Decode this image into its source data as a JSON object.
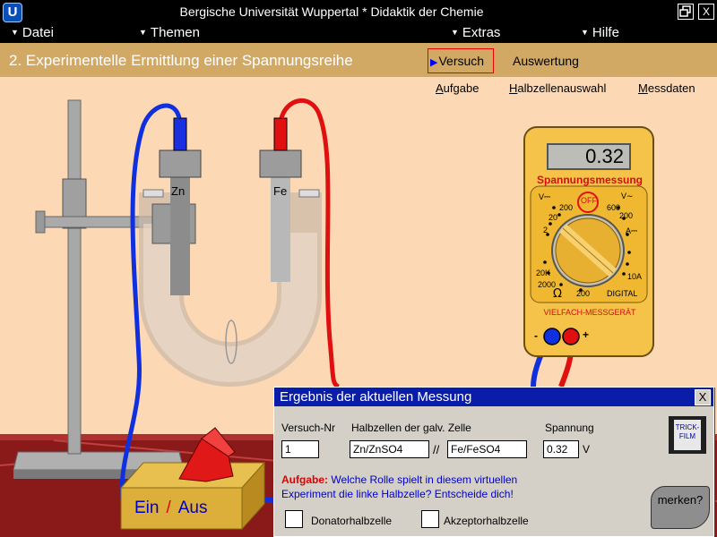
{
  "window": {
    "title": "Bergische Universität Wuppertal   *   Didaktik der Chemie",
    "logo": "U",
    "restore_icon": "restore-icon",
    "close_label": "X"
  },
  "menu": {
    "items": [
      "Datei",
      "Themen",
      "Extras",
      "Hilfe"
    ]
  },
  "header": {
    "page_title": "2. Experimentelle Ermittlung einer Spannungsreihe",
    "tabs": [
      "Versuch",
      "Auswertung"
    ],
    "active_tab": "Versuch"
  },
  "sublinks": [
    {
      "first": "A",
      "rest": "ufgabe"
    },
    {
      "first": "H",
      "rest": "albzellenauswahl"
    },
    {
      "first": "M",
      "rest": "essdaten"
    }
  ],
  "apparatus": {
    "left_electrode": "Zn",
    "right_electrode": "Fe",
    "switch_on": "Ein",
    "switch_separator": "/",
    "switch_off": "Aus"
  },
  "multimeter": {
    "reading": "0.32",
    "heading": "Spannungsmessung",
    "brand": "VIELFACH-MESSGERÄT",
    "labels": {
      "v_dc": "V⎓",
      "off": "OFF",
      "v_ac": "V∼",
      "s200a": "200",
      "s20": "20",
      "s2": "2",
      "s600": "600",
      "s200b": "200",
      "a_dc": "A⎓",
      "s20k": "20K",
      "s2000": "2000",
      "s200c": "200",
      "s10a": "10A",
      "digital": "DIGITAL",
      "minus": "-",
      "plus": "+"
    },
    "colors": {
      "body": "#f5c34a",
      "knob": "#e8b030",
      "lead_negative": "#1030e0",
      "lead_positive": "#e01010"
    }
  },
  "dialog": {
    "title": "Ergebnis der aktuellen Messung",
    "close_label": "X",
    "col_nr": "Versuch-Nr",
    "col_cell": "Halbzellen der galv. Zelle",
    "col_voltage": "Spannung",
    "nr": "1",
    "left_cell": "Zn/ZnSO4",
    "separator": "//",
    "right_cell": "Fe/FeSO4",
    "voltage": "0.32",
    "unit": "V",
    "film_line1": "TRICK-",
    "film_line2": "FILM",
    "task_label": "Aufgabe:",
    "task_text1": "Welche Rolle spielt in diesem virtuellen",
    "task_text2": "Experiment die linke Halbzelle? Entscheide dich!",
    "option1": "Donatorhalbzelle",
    "option2": "Akzeptorhalbzelle",
    "merken": "merken?"
  }
}
